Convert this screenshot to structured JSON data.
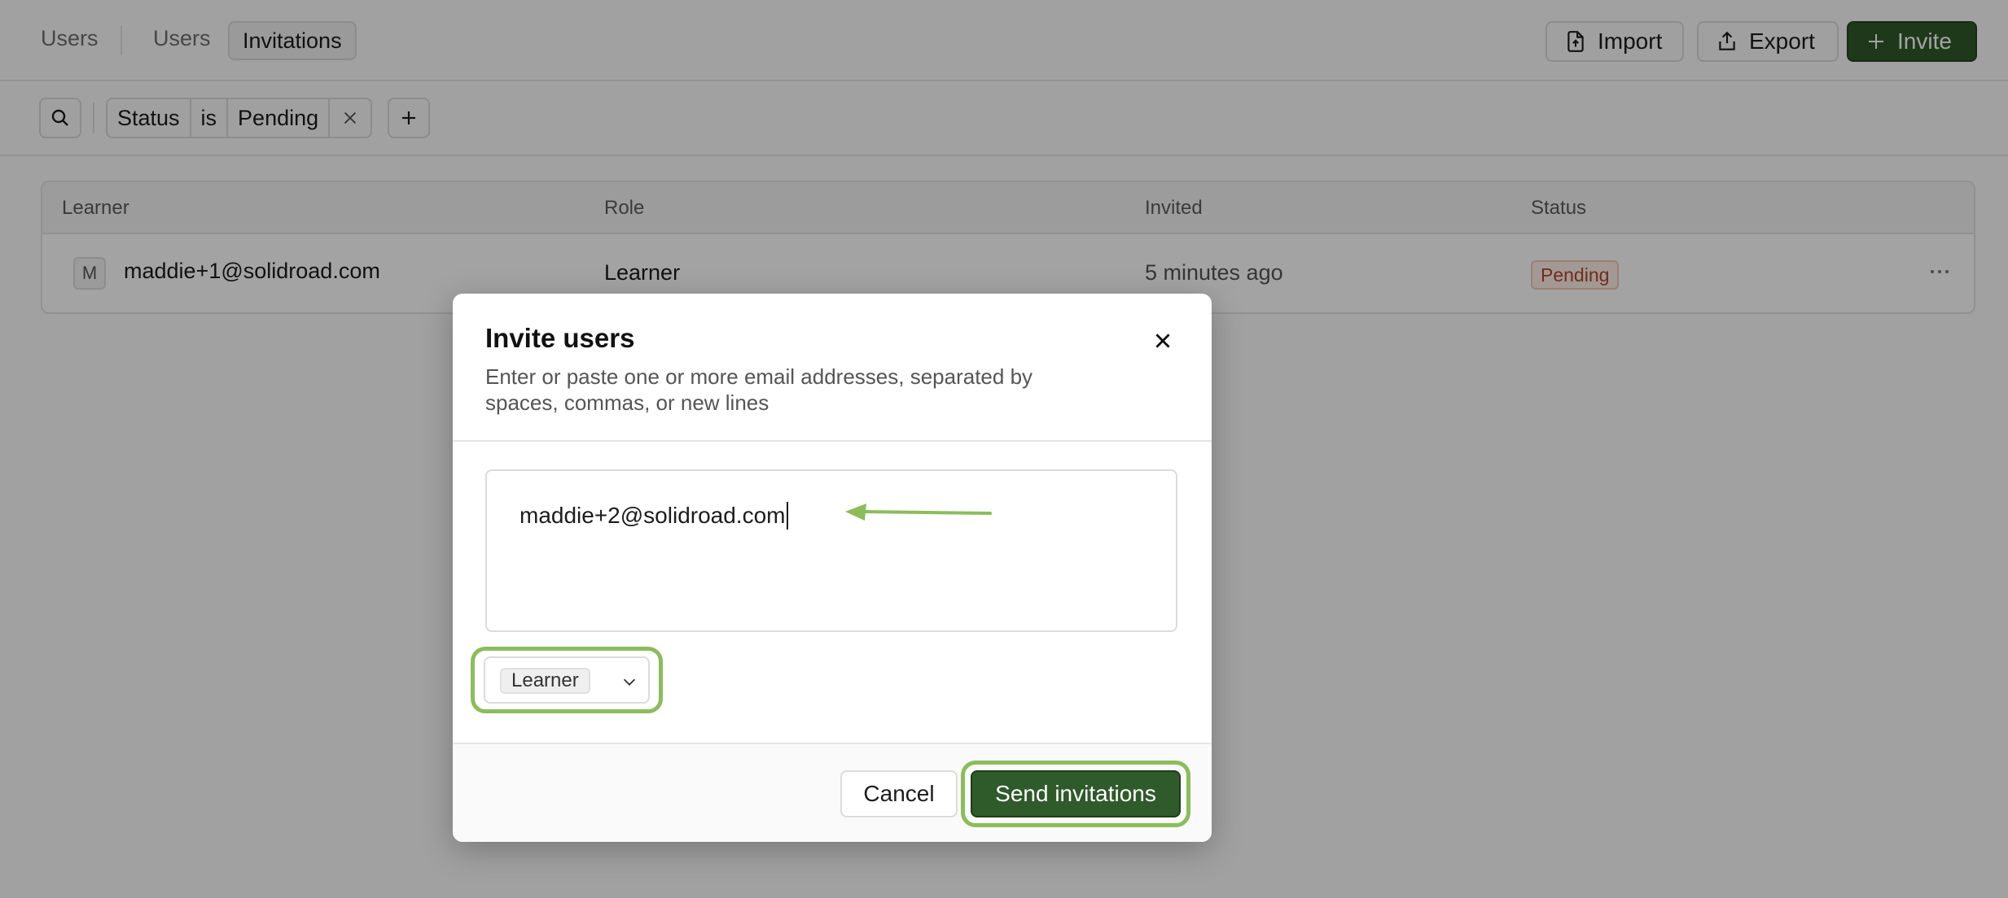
{
  "header": {
    "root_crumb": "Users",
    "tabs": [
      {
        "label": "Users",
        "active": false
      },
      {
        "label": "Invitations",
        "active": true
      }
    ],
    "import_label": "Import",
    "export_label": "Export",
    "invite_label": "Invite",
    "accent_color": "#2f5a2a"
  },
  "filters": {
    "chip": {
      "field": "Status",
      "operator": "is",
      "value": "Pending"
    }
  },
  "table": {
    "columns": [
      "Learner",
      "Role",
      "Invited",
      "Status"
    ],
    "rows": [
      {
        "avatar_initial": "M",
        "learner": "maddie+1@solidroad.com",
        "role": "Learner",
        "invited": "5 minutes ago",
        "status": "Pending"
      }
    ]
  },
  "dialog": {
    "title": "Invite users",
    "description": "Enter or paste one or more email addresses, separated by spaces, commas, or new lines",
    "email_input_value": "maddie+2@solidroad.com",
    "role_value": "Learner",
    "cancel_label": "Cancel",
    "send_label": "Send invitations",
    "highlight_color": "#8bbd5a"
  },
  "icons": {
    "import": "file-upload-icon",
    "export": "share-upload-icon",
    "invite": "plus-icon",
    "search": "search-icon",
    "remove_filter": "close-icon",
    "add_filter": "plus-icon",
    "row_menu": "more-horizontal-icon",
    "dialog_close": "close-icon",
    "role_dropdown": "chevron-down-icon",
    "annotation": "arrow-left-icon"
  }
}
